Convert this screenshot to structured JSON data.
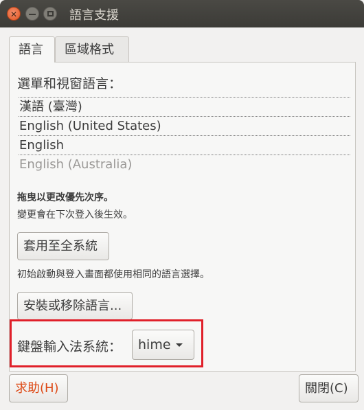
{
  "window": {
    "title": "語言支援"
  },
  "titlebar": {
    "close_glyph": "✕"
  },
  "tabs": [
    {
      "label": "語言",
      "active": true
    },
    {
      "label": "區域格式",
      "active": false
    }
  ],
  "language": {
    "menu_label": "選單和視窗語言：",
    "items": [
      {
        "label": "漢語 (臺灣)",
        "enabled": true
      },
      {
        "label": "English (United States)",
        "enabled": true
      },
      {
        "label": "English",
        "enabled": true
      },
      {
        "label": "English (Australia)",
        "enabled": false
      }
    ],
    "drag_hint": "拖曳以更改優先次序。",
    "change_hint": "變更會在下次登入後生效。",
    "apply_label": "套用至全系統",
    "startup_hint": "初始啟動與登入畫面都使用相同的語言選擇。",
    "install_label": "安裝或移除語言...",
    "keyboard_label": "鍵盤輸入法系統：",
    "keyboard_value": "hime"
  },
  "footer": {
    "help_label": "求助(H)",
    "close_label": "關閉(C)"
  },
  "colors": {
    "accent": "#dd4814",
    "highlight": "#e0202a"
  }
}
